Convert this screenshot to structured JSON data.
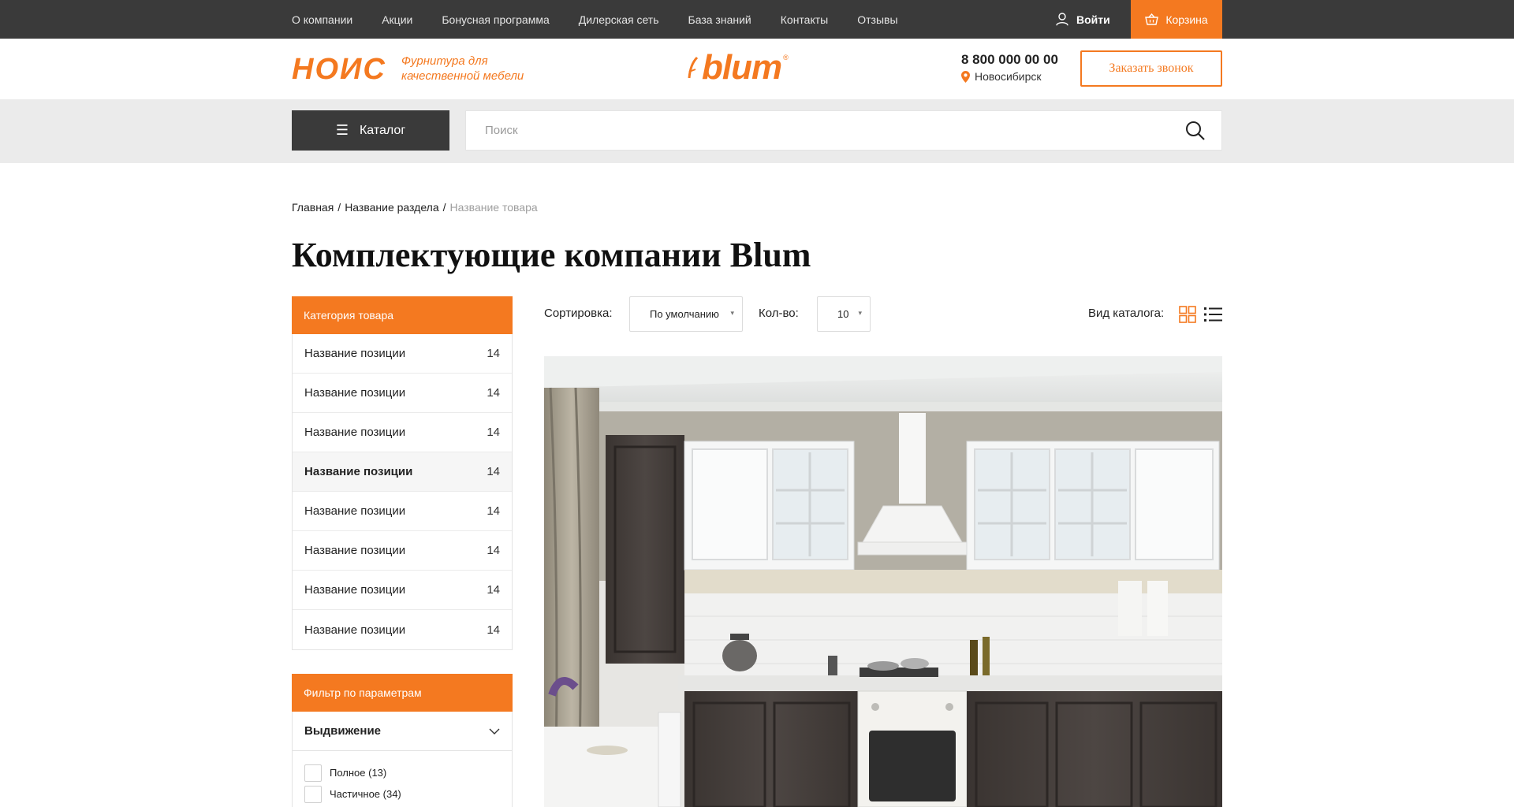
{
  "topnav": {
    "items": [
      "О компании",
      "Акции",
      "Бонусная программа",
      "Дилерская сеть",
      "База знаний",
      "Контакты",
      "Отзывы"
    ],
    "login_label": "Войти",
    "cart_label": "Корзина"
  },
  "header": {
    "logo": "НОИС",
    "tagline": "Фурнитура для качественной мебели",
    "brand": "blum",
    "brand_mark": "®",
    "phone": "8 800 000 00 00",
    "city": "Новосибирск",
    "callback_label": "Заказать звонок"
  },
  "search": {
    "catalog_label": "Каталог",
    "placeholder": "Поиск",
    "value": ""
  },
  "breadcrumb": {
    "items": [
      "Главная",
      "Название раздела"
    ],
    "current": "Название товара",
    "separator": "/"
  },
  "page_title": "Комплектующие компании Blum",
  "sidebar": {
    "category_title": "Категория товара",
    "categories": [
      {
        "label": "Название позиции",
        "count": "14",
        "active": false
      },
      {
        "label": "Название позиции",
        "count": "14",
        "active": false
      },
      {
        "label": "Название позиции",
        "count": "14",
        "active": false
      },
      {
        "label": "Название позиции",
        "count": "14",
        "active": true
      },
      {
        "label": "Название позиции",
        "count": "14",
        "active": false
      },
      {
        "label": "Название позиции",
        "count": "14",
        "active": false
      },
      {
        "label": "Название позиции",
        "count": "14",
        "active": false
      },
      {
        "label": "Название позиции",
        "count": "14",
        "active": false
      }
    ],
    "filter_title": "Фильтр по параметрам",
    "filter_group": "Выдвижение",
    "filter_options": [
      "Полное (13)",
      "Частичное (34)"
    ]
  },
  "toolbar": {
    "sort_label": "Сортировка:",
    "sort_value": "По умолчанию",
    "count_label": "Кол-во:",
    "count_value": "10",
    "view_label": "Вид каталога:"
  },
  "icons": {
    "login": "user-icon",
    "cart": "basket-icon",
    "city": "map-pin-icon",
    "catalog": "burger-menu-icon",
    "search": "search-icon",
    "grid_view": "grid-view-icon",
    "list_view": "list-view-icon",
    "filter_toggle": "chevron-down-icon"
  },
  "colors": {
    "accent": "#f47920",
    "topbar": "#3a3a3a",
    "band": "#ebebeb"
  }
}
